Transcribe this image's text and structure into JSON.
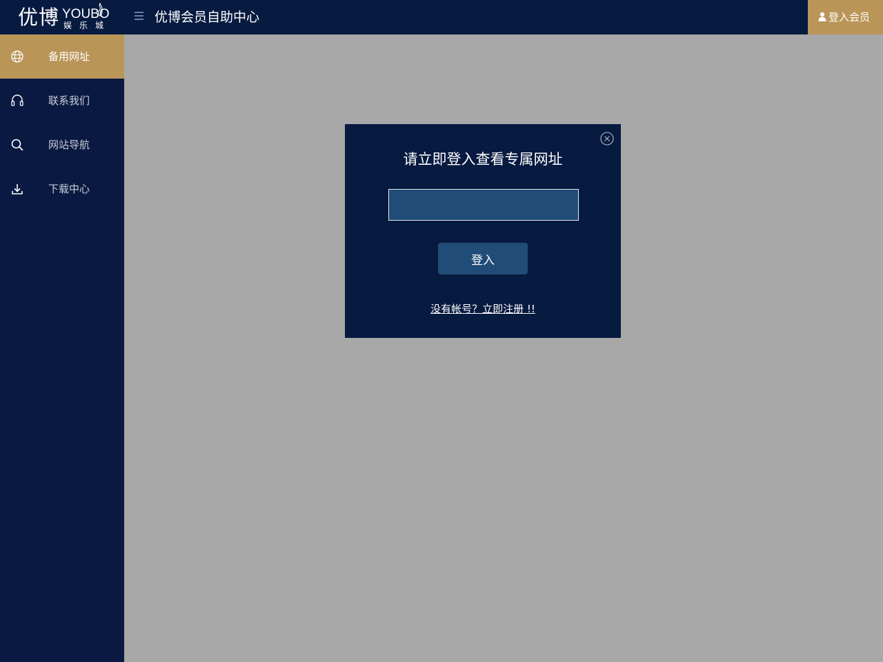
{
  "logo": {
    "chinese": "优博",
    "english": "YOUBO",
    "subtitle": "娱乐城"
  },
  "header": {
    "title": "优博会员自助中心",
    "login_label": "登入会员"
  },
  "sidebar": {
    "items": [
      {
        "label": "备用网址",
        "icon": "globe-icon",
        "active": true
      },
      {
        "label": "联系我们",
        "icon": "headset-icon",
        "active": false
      },
      {
        "label": "网站导航",
        "icon": "search-icon",
        "active": false
      },
      {
        "label": "下载中心",
        "icon": "download-icon",
        "active": false
      }
    ]
  },
  "modal": {
    "title": "请立即登入查看专属网址",
    "input_value": "",
    "submit_label": "登入",
    "register_link": "没有帐号？立即注册 !!"
  },
  "colors": {
    "sidebar_bg": "#091941",
    "header_bg": "#071a40",
    "accent_gold": "#b99558",
    "overlay_gray": "#a8a8a8",
    "input_blue": "#204c77"
  }
}
